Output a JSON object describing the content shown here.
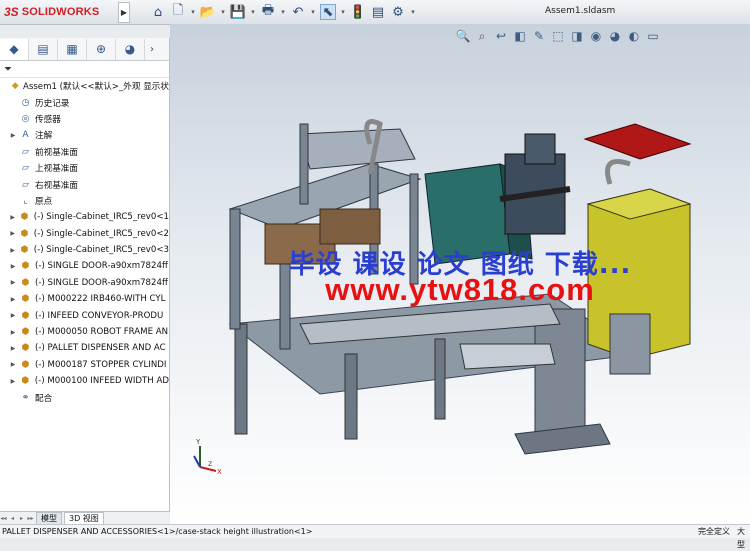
{
  "app": {
    "brand_mark": "3S",
    "brand_name": "SOLIDWORKS",
    "menu_arrow": "▶",
    "document_title": "Assem1.sldasm"
  },
  "toolbar": [
    {
      "icon": "home-icon",
      "glyph": "⌂"
    },
    {
      "icon": "new-document-icon",
      "glyph": "🗋"
    },
    {
      "icon": "dropdown-arrow-icon",
      "glyph": "▾"
    },
    {
      "icon": "open-folder-icon",
      "glyph": "📂"
    },
    {
      "icon": "dropdown-arrow-icon",
      "glyph": "▾"
    },
    {
      "icon": "save-icon",
      "glyph": "💾"
    },
    {
      "icon": "dropdown-arrow-icon",
      "glyph": "▾"
    },
    {
      "icon": "print-icon",
      "glyph": "🖶"
    },
    {
      "icon": "dropdown-arrow-icon",
      "glyph": "▾"
    },
    {
      "icon": "undo-icon",
      "glyph": "↶"
    },
    {
      "icon": "dropdown-arrow-icon",
      "glyph": "▾"
    },
    {
      "icon": "select-cursor-icon",
      "glyph": "⬉"
    },
    {
      "icon": "dropdown-arrow-icon",
      "glyph": "▾"
    },
    {
      "icon": "rebuild-traffic-light-icon",
      "glyph": "🚦"
    },
    {
      "icon": "file-properties-icon",
      "glyph": "▤"
    },
    {
      "icon": "options-gear-icon",
      "glyph": "⚙"
    },
    {
      "icon": "dropdown-arrow-icon",
      "glyph": "▾"
    }
  ],
  "heads_up_toolbar": [
    {
      "icon": "zoom-to-fit-icon",
      "glyph": "🔍"
    },
    {
      "icon": "zoom-to-area-icon",
      "glyph": "⌕"
    },
    {
      "icon": "previous-view-icon",
      "glyph": "↩"
    },
    {
      "icon": "section-view-icon",
      "glyph": "◧"
    },
    {
      "icon": "dynamic-annotation-icon",
      "glyph": "✎"
    },
    {
      "icon": "view-orientation-icon",
      "glyph": "⬚"
    },
    {
      "icon": "display-style-icon",
      "glyph": "◨"
    },
    {
      "icon": "hide-show-items-icon",
      "glyph": "◉"
    },
    {
      "icon": "edit-appearance-icon",
      "glyph": "◕"
    },
    {
      "icon": "apply-scene-icon",
      "glyph": "◐"
    },
    {
      "icon": "view-settings-icon",
      "glyph": "▭"
    }
  ],
  "feature_manager": {
    "tabs": [
      {
        "icon": "feature-manager-tree-icon",
        "glyph": "◆"
      },
      {
        "icon": "property-manager-icon",
        "glyph": "▤"
      },
      {
        "icon": "configuration-manager-icon",
        "glyph": "▦"
      },
      {
        "icon": "dimxpert-manager-icon",
        "glyph": "⊕"
      },
      {
        "icon": "display-manager-icon",
        "glyph": "◕"
      },
      {
        "icon": "more-tabs-arrow-icon",
        "glyph": "›"
      }
    ],
    "filter_icon": "⏷",
    "tree": [
      {
        "label": "Assem1  (默认<<默认>_外观 显示状",
        "toggle": "",
        "icon": "assembly-icon",
        "glyph": "◆",
        "kind": "root",
        "indent": 0
      },
      {
        "label": "历史记录",
        "toggle": "",
        "icon": "history-icon",
        "glyph": "◷",
        "kind": "item",
        "indent": 1
      },
      {
        "label": "传感器",
        "toggle": "",
        "icon": "sensor-icon",
        "glyph": "◎",
        "kind": "item",
        "indent": 1
      },
      {
        "label": "注解",
        "toggle": "▶",
        "icon": "annotations-icon",
        "glyph": "A",
        "kind": "item",
        "indent": 1
      },
      {
        "label": "前视基准面",
        "toggle": "",
        "icon": "plane-icon",
        "glyph": "▱",
        "kind": "item",
        "indent": 1
      },
      {
        "label": "上视基准面",
        "toggle": "",
        "icon": "plane-icon",
        "glyph": "▱",
        "kind": "item",
        "indent": 1
      },
      {
        "label": "右视基准面",
        "toggle": "",
        "icon": "plane-icon",
        "glyph": "▱",
        "kind": "item",
        "indent": 1
      },
      {
        "label": "原点",
        "toggle": "",
        "icon": "origin-icon",
        "glyph": "⌞",
        "kind": "item",
        "indent": 1
      },
      {
        "label": "(-) Single-Cabinet_IRC5_rev0<1",
        "toggle": "▶",
        "icon": "component-icon",
        "glyph": "⬢",
        "kind": "comp",
        "indent": 1
      },
      {
        "label": "(-) Single-Cabinet_IRC5_rev0<2",
        "toggle": "▶",
        "icon": "component-icon",
        "glyph": "⬢",
        "kind": "comp",
        "indent": 1
      },
      {
        "label": "(-) Single-Cabinet_IRC5_rev0<3",
        "toggle": "▶",
        "icon": "component-icon",
        "glyph": "⬢",
        "kind": "comp",
        "indent": 1
      },
      {
        "label": "(-) SINGLE DOOR-a90xm7824ff",
        "toggle": "▶",
        "icon": "component-icon",
        "glyph": "⬢",
        "kind": "comp",
        "indent": 1
      },
      {
        "label": "(-) SINGLE DOOR-a90xm7824ff",
        "toggle": "▶",
        "icon": "component-icon",
        "glyph": "⬢",
        "kind": "comp",
        "indent": 1
      },
      {
        "label": "(-) M000222 IRB460-WITH CYL",
        "toggle": "▶",
        "icon": "component-icon",
        "glyph": "⬢",
        "kind": "comp",
        "indent": 1
      },
      {
        "label": "(-) INFEED CONVEYOR-PRODU",
        "toggle": "▶",
        "icon": "component-icon",
        "glyph": "⬢",
        "kind": "comp",
        "indent": 1
      },
      {
        "label": "(-) M000050 ROBOT FRAME AN",
        "toggle": "▶",
        "icon": "component-icon",
        "glyph": "⬢",
        "kind": "comp",
        "indent": 1
      },
      {
        "label": "(-) PALLET DISPENSER AND AC",
        "toggle": "▶",
        "icon": "component-icon",
        "glyph": "⬢",
        "kind": "comp",
        "indent": 1
      },
      {
        "label": "(-) M000187 STOPPER CYLINDI",
        "toggle": "▶",
        "icon": "component-icon",
        "glyph": "⬢",
        "kind": "comp",
        "indent": 1
      },
      {
        "label": "(-) M000100 INFEED WIDTH AD",
        "toggle": "▶",
        "icon": "component-icon",
        "glyph": "⬢",
        "kind": "comp",
        "indent": 1
      },
      {
        "label": "配合",
        "toggle": "",
        "icon": "mates-icon",
        "glyph": "⚭",
        "kind": "item",
        "indent": 1
      }
    ]
  },
  "bottom_tabs": {
    "nav": [
      "◂◂",
      "◂",
      "▸",
      "▸▸"
    ],
    "model": "模型",
    "view3d": "3D 视图"
  },
  "status_bar": {
    "left": "PALLET DISPENSER AND ACCESSORIES<1>/case-stack height illustration<1>",
    "state": "完全定义",
    "extra": "大型"
  },
  "watermark": {
    "line1": "毕设 课设 论文 图纸 下载...",
    "line2": "www.ytw818.com"
  },
  "triad": {
    "y": "Y",
    "x": "X",
    "z": "Z"
  },
  "colors": {
    "watermark_blue": "#2a3fd0",
    "watermark_red": "#e81010",
    "brand_red": "#d21f26"
  }
}
